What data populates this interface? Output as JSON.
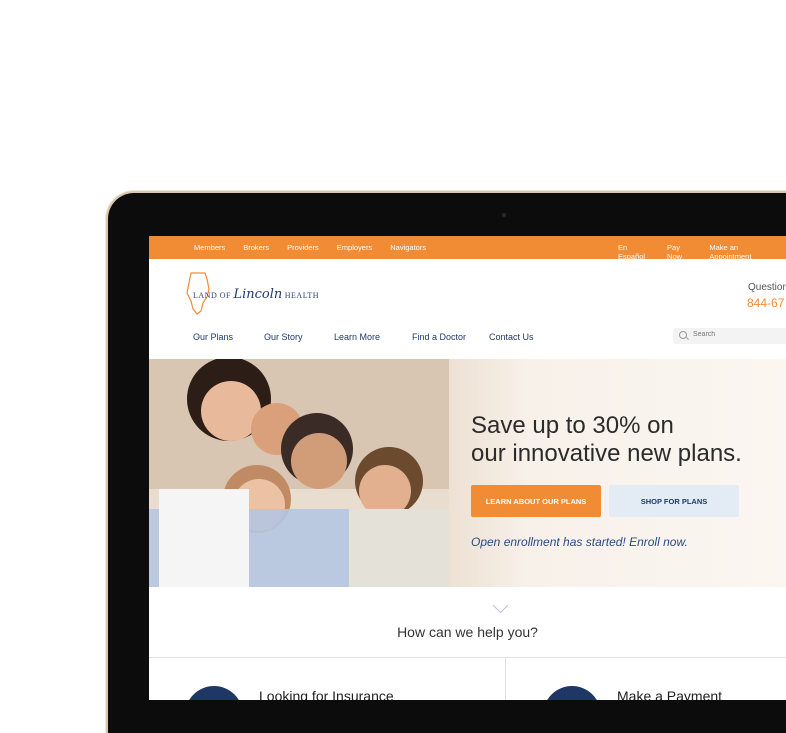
{
  "topbar": {
    "left": [
      "Members",
      "Brokers",
      "Providers",
      "Employers",
      "Navigators"
    ],
    "right": [
      "En Español",
      "Pay Now",
      "Make an Appointment"
    ]
  },
  "brand": {
    "name_prefix": "LAND OF",
    "name_script": "Lincoln",
    "name_suffix": "HEALTH"
  },
  "contact": {
    "question": "Question",
    "phone": "844-67"
  },
  "nav": {
    "items": [
      "Our Plans",
      "Our Story",
      "Learn More",
      "Find a Doctor",
      "Contact Us"
    ],
    "search_placeholder": "Search"
  },
  "hero": {
    "line1": "Save up to 30% on",
    "line2": "our innovative new plans.",
    "primary_button": "LEARN ABOUT OUR PLANS",
    "secondary_button": "SHOP FOR PLANS",
    "note": "Open enrollment has started! Enroll now."
  },
  "help": {
    "title": "How can we help you?",
    "cards": [
      "Looking for Insurance",
      "Make a Payment"
    ]
  },
  "colors": {
    "accent_orange": "#f28c34",
    "navy": "#1f3764"
  }
}
